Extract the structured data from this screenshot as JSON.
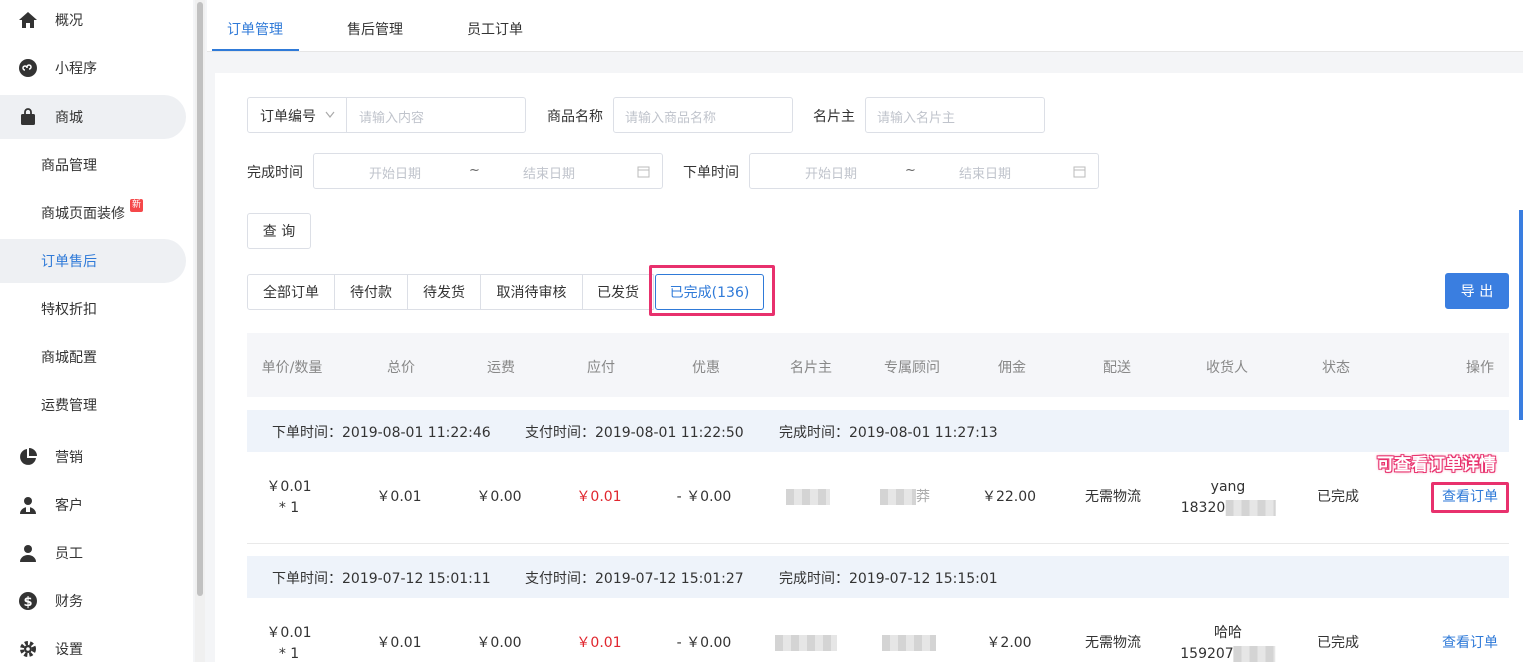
{
  "sidebar": {
    "items": [
      {
        "label": "概况",
        "icon": "home-icon"
      },
      {
        "label": "小程序",
        "icon": "miniprogram-icon"
      },
      {
        "label": "商城",
        "icon": "shopping-bag-icon"
      },
      {
        "label": "营销",
        "icon": "pie-chart-icon"
      },
      {
        "label": "客户",
        "icon": "customers-icon"
      },
      {
        "label": "员工",
        "icon": "employee-icon"
      },
      {
        "label": "财务",
        "icon": "dollar-icon"
      },
      {
        "label": "设置",
        "icon": "gear-icon"
      }
    ],
    "shop_sub": [
      {
        "label": "商品管理"
      },
      {
        "label": "商城页面装修",
        "badge": "新"
      },
      {
        "label": "订单售后"
      },
      {
        "label": "特权折扣"
      },
      {
        "label": "商城配置"
      },
      {
        "label": "运费管理"
      }
    ]
  },
  "tabs": [
    {
      "label": "订单管理"
    },
    {
      "label": "售后管理"
    },
    {
      "label": "员工订单"
    }
  ],
  "filters": {
    "order_select": "订单编号",
    "order_placeholder": "请输入内容",
    "product_label": "商品名称",
    "product_placeholder": "请输入商品名称",
    "card_owner_label": "名片主",
    "card_owner_placeholder": "请输入名片主",
    "complete_time_label": "完成时间",
    "order_time_label": "下单时间",
    "start_placeholder": "开始日期",
    "range_sep": "~",
    "end_placeholder": "结束日期",
    "query_button": "查 询"
  },
  "status_tabs": [
    {
      "label": "全部订单"
    },
    {
      "label": "待付款"
    },
    {
      "label": "待发货"
    },
    {
      "label": "取消待审核"
    },
    {
      "label": "已发货"
    },
    {
      "label": "已完成(136)"
    }
  ],
  "export_button": "导 出",
  "table": {
    "columns": [
      "单价/数量",
      "总价",
      "运费",
      "应付",
      "优惠",
      "名片主",
      "专属顾问",
      "佣金",
      "配送",
      "收货人",
      "状态",
      "操作"
    ],
    "orders": [
      {
        "order_time": "下单时间：2019-08-01 11:22:46",
        "pay_time": "支付时间：2019-08-01 11:22:50",
        "complete_time": "完成时间：2019-08-01 11:27:13",
        "unit_price": "￥0.01",
        "qty": "* 1",
        "total": "￥0.01",
        "shipping": "￥0.00",
        "payable": "￥0.01",
        "discount": "- ￥0.00",
        "advisor_suffix": "莽",
        "commission": "￥22.00",
        "delivery": "无需物流",
        "receiver_name": "yang",
        "receiver_phone": "18320",
        "status": "已完成",
        "action": "查看订单"
      },
      {
        "order_time": "下单时间：2019-07-12 15:01:11",
        "pay_time": "支付时间：2019-07-12 15:01:27",
        "complete_time": "完成时间：2019-07-12 15:15:01",
        "unit_price": "￥0.01",
        "qty": "* 1",
        "total": "￥0.01",
        "shipping": "￥0.00",
        "payable": "￥0.01",
        "discount": "- ￥0.00",
        "advisor_suffix": "",
        "commission": "￥2.00",
        "delivery": "无需物流",
        "receiver_name": "哈哈",
        "receiver_phone": "159207",
        "status": "已完成",
        "action": "查看订单"
      }
    ]
  },
  "annotation": "可查看订单详情",
  "colors": {
    "accent": "#2f7ad8",
    "highlight": "#e8316d",
    "price_red": "#e0262e"
  }
}
